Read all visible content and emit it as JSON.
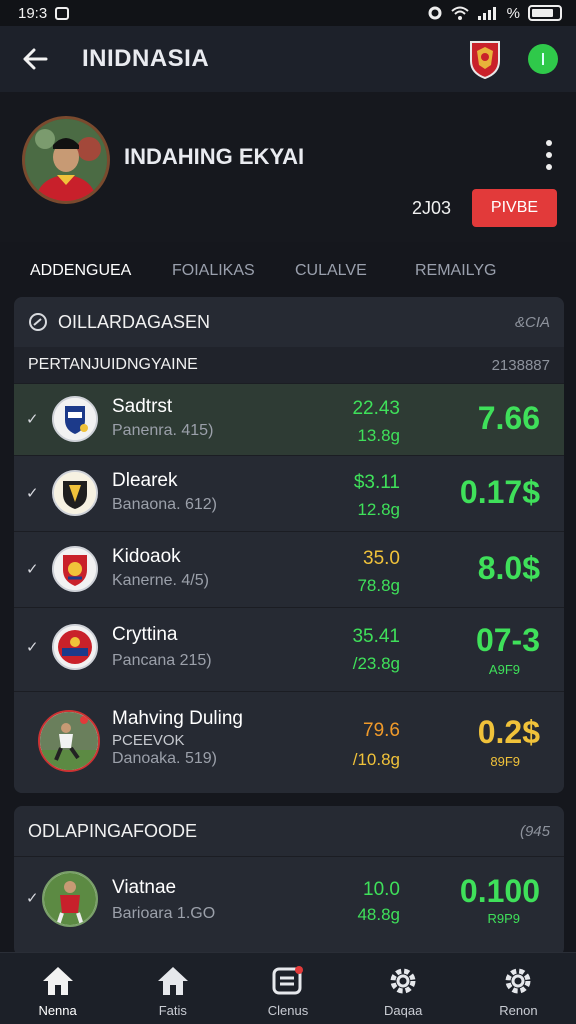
{
  "status_bar": {
    "time": "19:3",
    "signal_text": "%"
  },
  "app_bar": {
    "title": "INIDNASIA"
  },
  "profile": {
    "name": "INDAHING EKYAI",
    "count": "2J03",
    "action_label": "PIVBE"
  },
  "tabs": [
    {
      "label": "ADDENGUEA",
      "active": true
    },
    {
      "label": "FOIALIKAS",
      "active": false
    },
    {
      "label": "CULALVE",
      "active": false
    },
    {
      "label": "REMAILYG",
      "active": false
    }
  ],
  "section1": {
    "title": "OILLARDAGASEN",
    "meta": "&CIA",
    "sub_title": "PERTANJUIDNGYAINE",
    "sub_meta": "2138887",
    "rows": [
      {
        "name": "Sadtrst",
        "sub": "Panenra. 415)",
        "odd_top": "22.43",
        "odd_bottom": "13.8g",
        "big": "7.66",
        "big_sub": ""
      },
      {
        "name": "Dlearek",
        "sub": "Banaona. 612)",
        "odd_top": "$3.11",
        "odd_bottom": "12.8g",
        "big": "0.17$",
        "big_sub": ""
      },
      {
        "name": "Kidoaok",
        "sub": "Kanerne. 4/5)",
        "odd_top": "35.0",
        "odd_bottom": "78.8g",
        "big": "8.0$",
        "big_sub": ""
      },
      {
        "name": "Cryttina",
        "sub": "Pancana 215)",
        "odd_top": "35.41",
        "odd_bottom": "/23.8g",
        "big": "07-3",
        "big_sub": "A9F9"
      },
      {
        "name": "Mahving Duling",
        "sub2": "PCEEVOK",
        "sub": "Danoaka. 519)",
        "odd_top": "79.6",
        "odd_bottom": "/10.8g",
        "big": "0.2$",
        "big_sub": "89F9"
      }
    ]
  },
  "section2": {
    "title": "ODLAPINGAFOODE",
    "meta": "(945",
    "rows": [
      {
        "name": "Viatnae",
        "sub": "Barioara 1.GO",
        "odd_top": "10.0",
        "odd_bottom": "48.8g",
        "big": "0.100",
        "big_sub": "R9P9"
      }
    ]
  },
  "bottom_nav": [
    {
      "label": "Nenna",
      "icon": "home-icon",
      "active": true
    },
    {
      "label": "Fatis",
      "icon": "home-icon",
      "active": false
    },
    {
      "label": "Clenus",
      "icon": "message-icon",
      "active": false
    },
    {
      "label": "Daqaa",
      "icon": "gear-icon",
      "active": false
    },
    {
      "label": "Renon",
      "icon": "gear-icon",
      "active": false
    }
  ],
  "colors": {
    "accent_green": "#3fe05a",
    "accent_yellow": "#f0c23a",
    "accent_orange": "#f09a2a",
    "accent_red": "#e23a3a",
    "background": "#15171d"
  }
}
